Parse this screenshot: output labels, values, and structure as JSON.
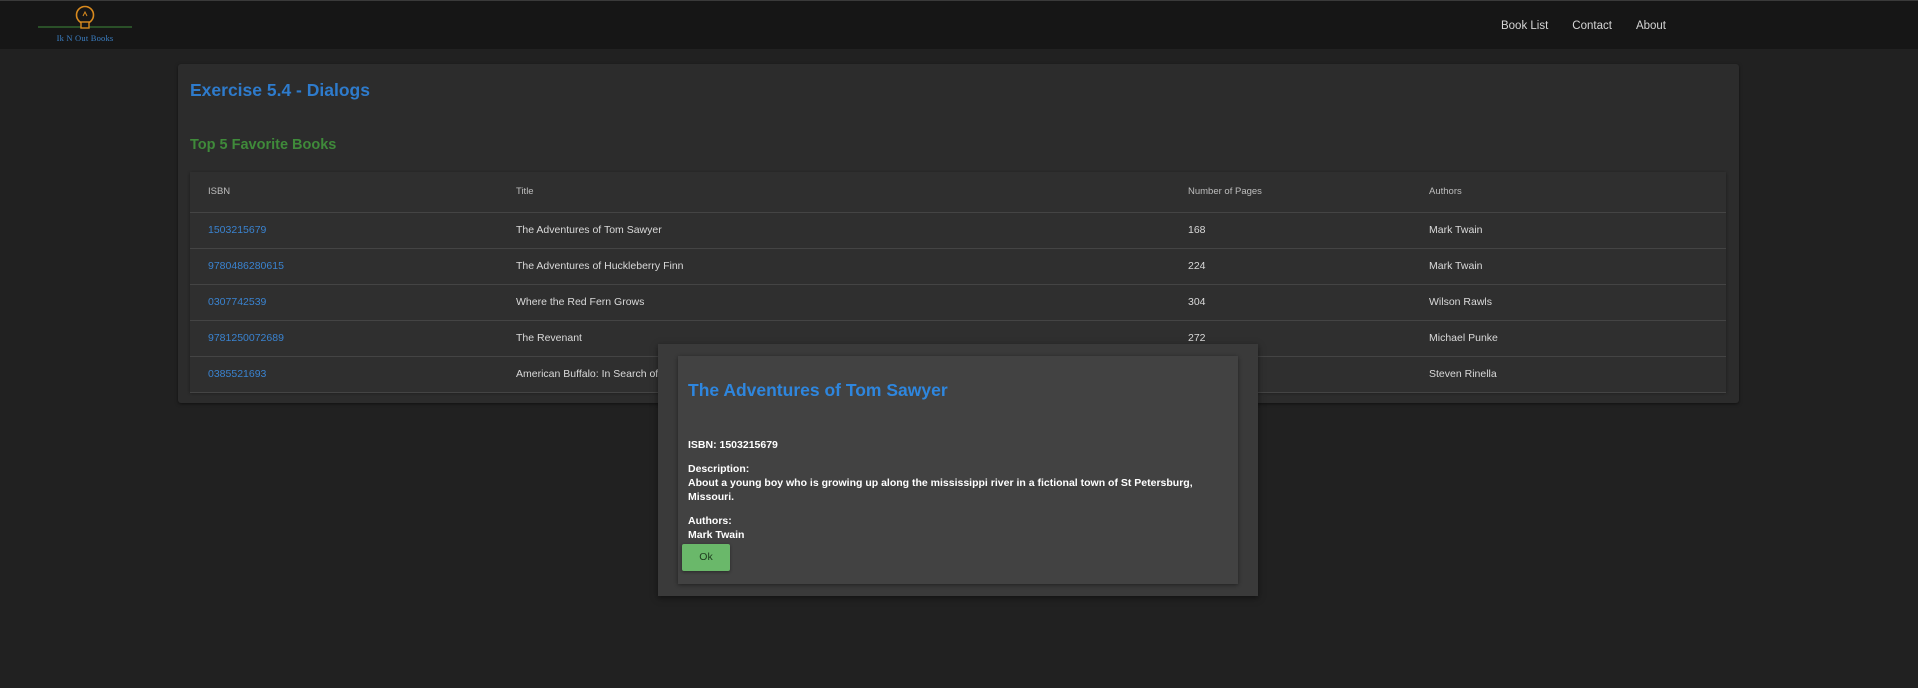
{
  "header": {
    "logo_text": "Ik N Out Books",
    "nav": [
      "Book List",
      "Contact",
      "About"
    ]
  },
  "card": {
    "title": "Exercise 5.4 - Dialogs",
    "section_title": "Top 5 Favorite Books"
  },
  "table": {
    "columns": [
      "ISBN",
      "Title",
      "Number of Pages",
      "Authors"
    ],
    "rows": [
      [
        "1503215679",
        "The Adventures of Tom Sawyer",
        "168",
        "Mark Twain"
      ],
      [
        "9780486280615",
        "The Adventures of Huckleberry Finn",
        "224",
        "Mark Twain"
      ],
      [
        "0307742539",
        "Where the Red Fern Grows",
        "304",
        "Wilson Rawls"
      ],
      [
        "9781250072689",
        "The Revenant",
        "272",
        "Michael Punke"
      ],
      [
        "0385521693",
        "American Buffalo: In Search of",
        "",
        "Steven Rinella"
      ]
    ]
  },
  "dialog": {
    "title": "The Adventures of Tom Sawyer",
    "isbn_line": "ISBN: 1503215679",
    "description_label": "Description:",
    "description": "About a young boy who is growing up along the mississippi river in a fictional town of St Petersburg, Missouri.",
    "authors_label": "Authors:",
    "authors": "Mark Twain",
    "ok_label": "Ok"
  },
  "colors": {
    "accent_blue": "#2e7bcc",
    "section_green": "#3f8a3a",
    "ok_button": "#6ab86a",
    "logo_bulb": "#d98a1e"
  }
}
